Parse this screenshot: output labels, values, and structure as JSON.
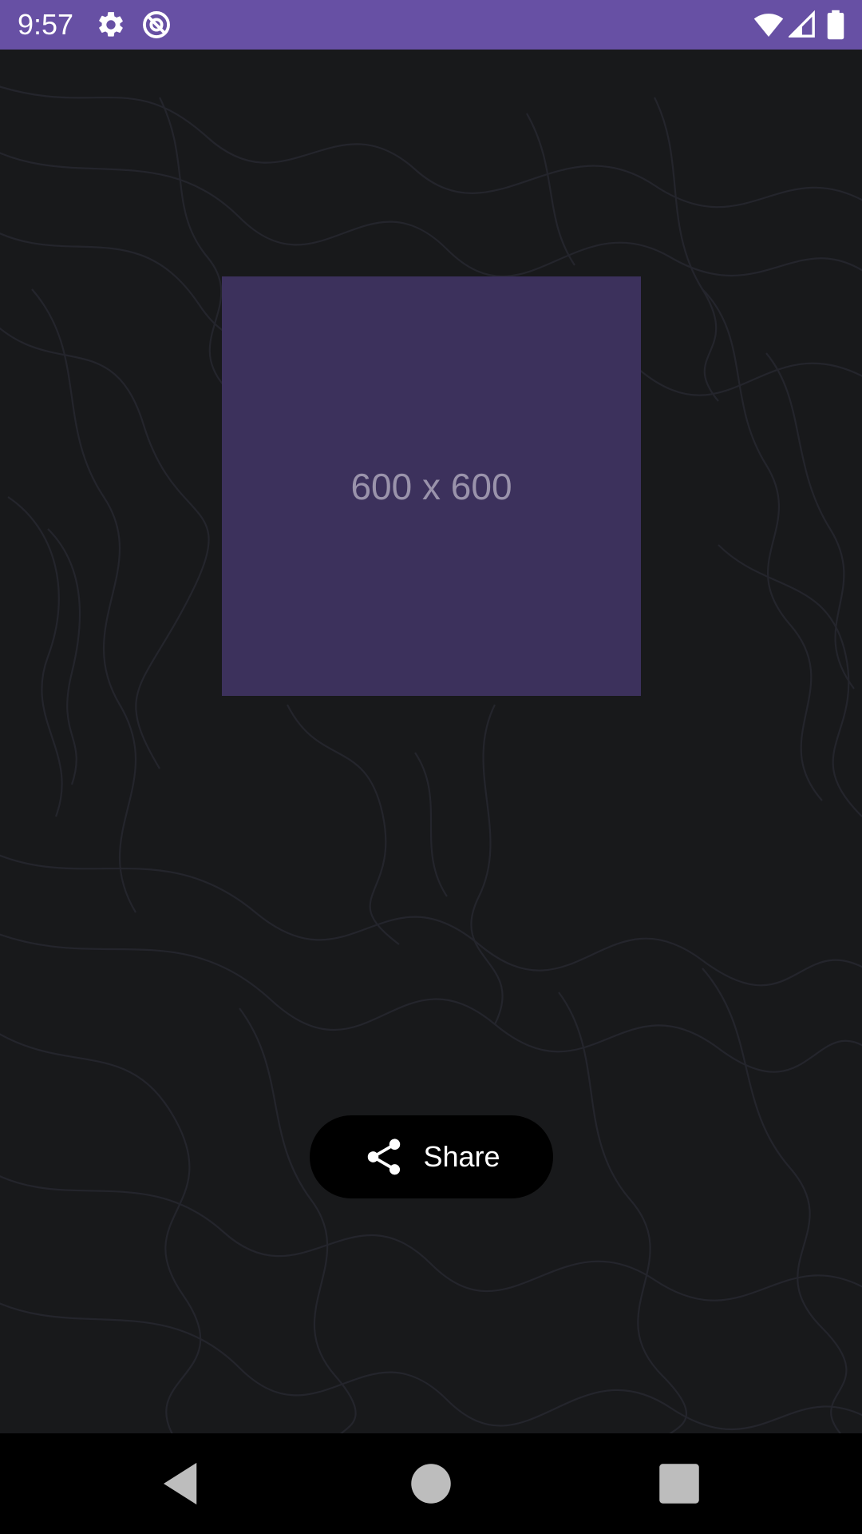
{
  "status_bar": {
    "time": "9:57",
    "background": "#6750a4",
    "left_icons": [
      "gear-icon",
      "no-sync-icon"
    ],
    "right_icons": [
      "wifi-icon",
      "signal-icon",
      "battery-icon"
    ]
  },
  "background": {
    "color": "#18191b",
    "pattern": "topographic-lines"
  },
  "placeholder": {
    "label": "600 x 600",
    "fill": "#3c315c",
    "text_color": "#9a93ab"
  },
  "share_button": {
    "label": "Share",
    "icon": "share-icon",
    "background": "#000000"
  },
  "nav_bar": {
    "buttons": [
      "back-icon",
      "home-icon",
      "recents-icon"
    ]
  }
}
